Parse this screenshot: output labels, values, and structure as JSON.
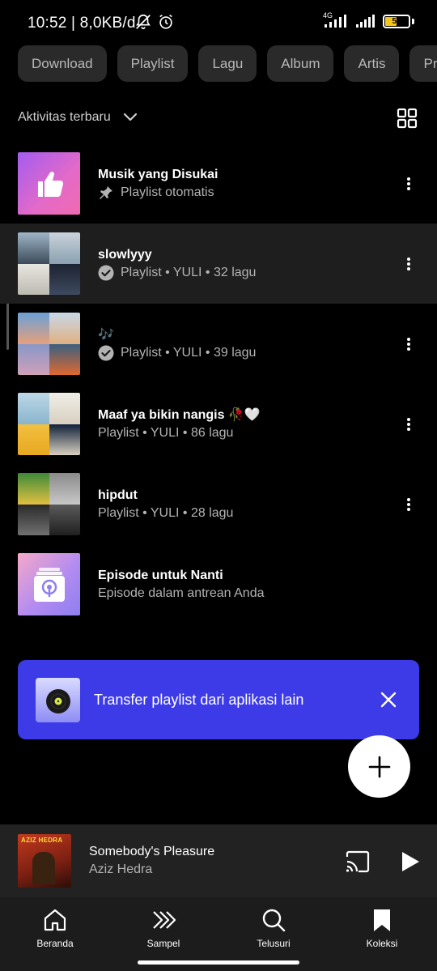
{
  "status_bar": {
    "time": "10:52 | 8,0KB/d",
    "network": "4G",
    "battery": "50",
    "battery_level": 0.5
  },
  "chips": [
    "Download",
    "Playlist",
    "Lagu",
    "Album",
    "Artis",
    "Profil"
  ],
  "sort": {
    "label": "Aktivitas terbaru"
  },
  "library": [
    {
      "title": "Musik yang Disukai",
      "subtitle": "Playlist otomatis",
      "sub_icon": "pin-icon",
      "thumb": "liked-songs"
    },
    {
      "title": "slowlyyy",
      "subtitle": "Playlist • YULI • 32 lagu",
      "sub_icon": "downloaded-icon",
      "thumb": "collage"
    },
    {
      "title": "🎶",
      "subtitle": "Playlist • YULI • 39 lagu",
      "sub_icon": "downloaded-icon",
      "thumb": "collage"
    },
    {
      "title": "Maaf ya bikin nangis 🥀🤍",
      "subtitle": "Playlist • YULI • 86 lagu",
      "sub_icon": "",
      "thumb": "collage"
    },
    {
      "title": "hipdut",
      "subtitle": "Playlist • YULI • 28 lagu",
      "sub_icon": "",
      "thumb": "collage"
    },
    {
      "title": "Episode untuk Nanti",
      "subtitle": "Episode dalam antrean Anda",
      "sub_icon": "",
      "thumb": "episodes"
    }
  ],
  "banner": {
    "text": "Transfer playlist dari aplikasi lain"
  },
  "now_playing": {
    "title": "Somebody's Pleasure",
    "artist": "Aziz Hedra",
    "art_text": "AZIZ HEDRA"
  },
  "nav": [
    {
      "label": "Beranda",
      "icon": "home-icon"
    },
    {
      "label": "Sampel",
      "icon": "samples-icon"
    },
    {
      "label": "Telusuri",
      "icon": "search-icon"
    },
    {
      "label": "Koleksi",
      "icon": "library-icon"
    }
  ],
  "colors": {
    "background": "#000000",
    "banner": "#3d3ae8",
    "chip": "#2a2a2a",
    "secondary_text": "#b3b3b3"
  }
}
